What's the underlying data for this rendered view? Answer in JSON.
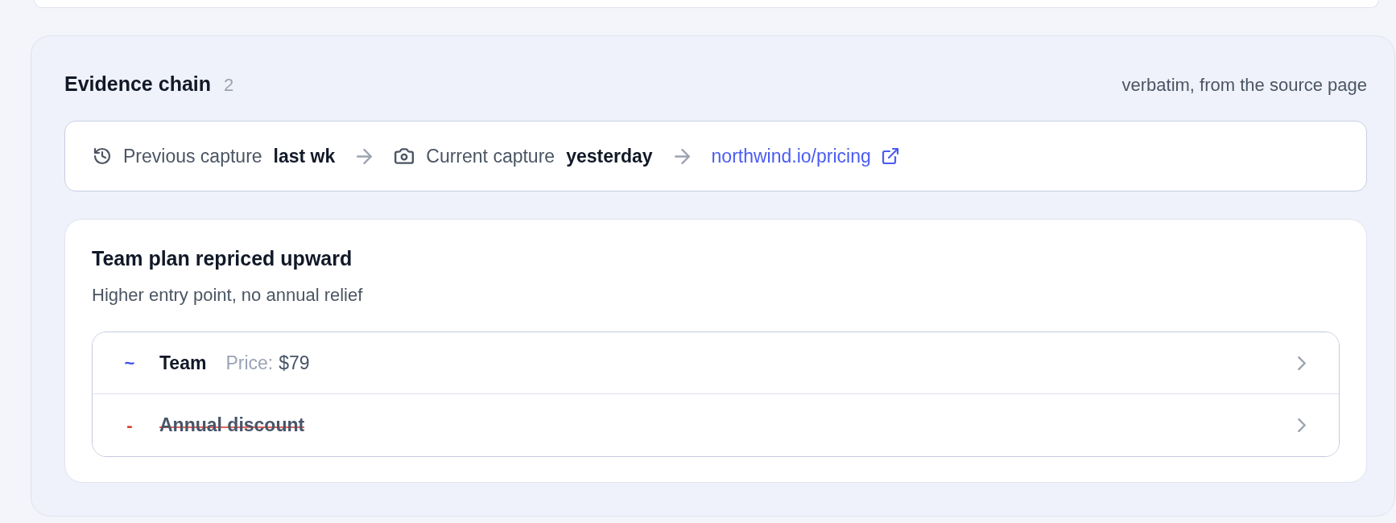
{
  "section": {
    "title": "Evidence chain",
    "count": "2",
    "note": "verbatim, from the source page"
  },
  "chain": [
    {
      "kind": "previous",
      "label": "Previous capture",
      "value": "last wk"
    },
    {
      "kind": "current",
      "label": "Current capture",
      "value": "yesterday"
    },
    {
      "kind": "source",
      "link": "northwind.io/pricing"
    }
  ],
  "finding": {
    "title": "Team plan repriced upward",
    "subtitle": "Higher entry point, no annual relief",
    "changes": [
      {
        "kind": "changed",
        "marker": "~",
        "name": "Team",
        "field": "Price:",
        "value": "$79"
      },
      {
        "kind": "removed",
        "marker": "-",
        "name": "Annual discount"
      }
    ]
  }
}
